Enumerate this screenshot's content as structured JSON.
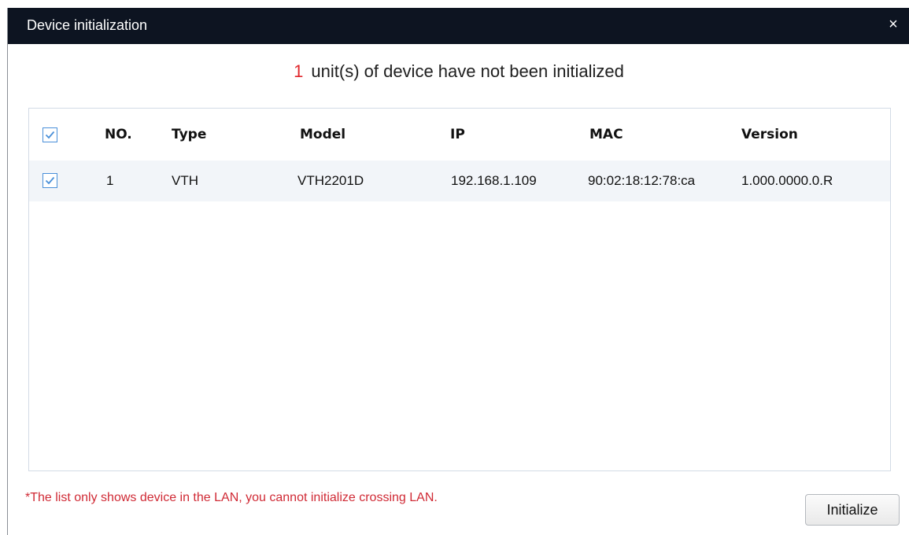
{
  "dialog": {
    "title": "Device initialization",
    "close_glyph": "×",
    "headline_count": "1",
    "headline_text": "unit(s) of device have not been initialized"
  },
  "table": {
    "headers": {
      "no": "NO.",
      "type": "Type",
      "model": "Model",
      "ip": "IP",
      "mac": "MAC",
      "version": "Version"
    },
    "select_all_checked": true,
    "rows": [
      {
        "checked": true,
        "no": "1",
        "type": "VTH",
        "model": "VTH2201D",
        "ip": "192.168.1.109",
        "mac": "90:02:18:12:78:ca",
        "version": "1.000.0000.0.R"
      }
    ]
  },
  "footer": {
    "note": "*The list only shows device in the LAN, you cannot initialize crossing LAN.",
    "initialize_label": "Initialize"
  },
  "colors": {
    "titlebar": "#0d1421",
    "accent_red": "#e0262b",
    "note_red": "#d02a35",
    "checkbox_blue": "#4a90d9",
    "row_highlight": "#f2f5f9"
  },
  "icons": {
    "close": "close-icon",
    "checkbox": "checkmark-icon"
  }
}
